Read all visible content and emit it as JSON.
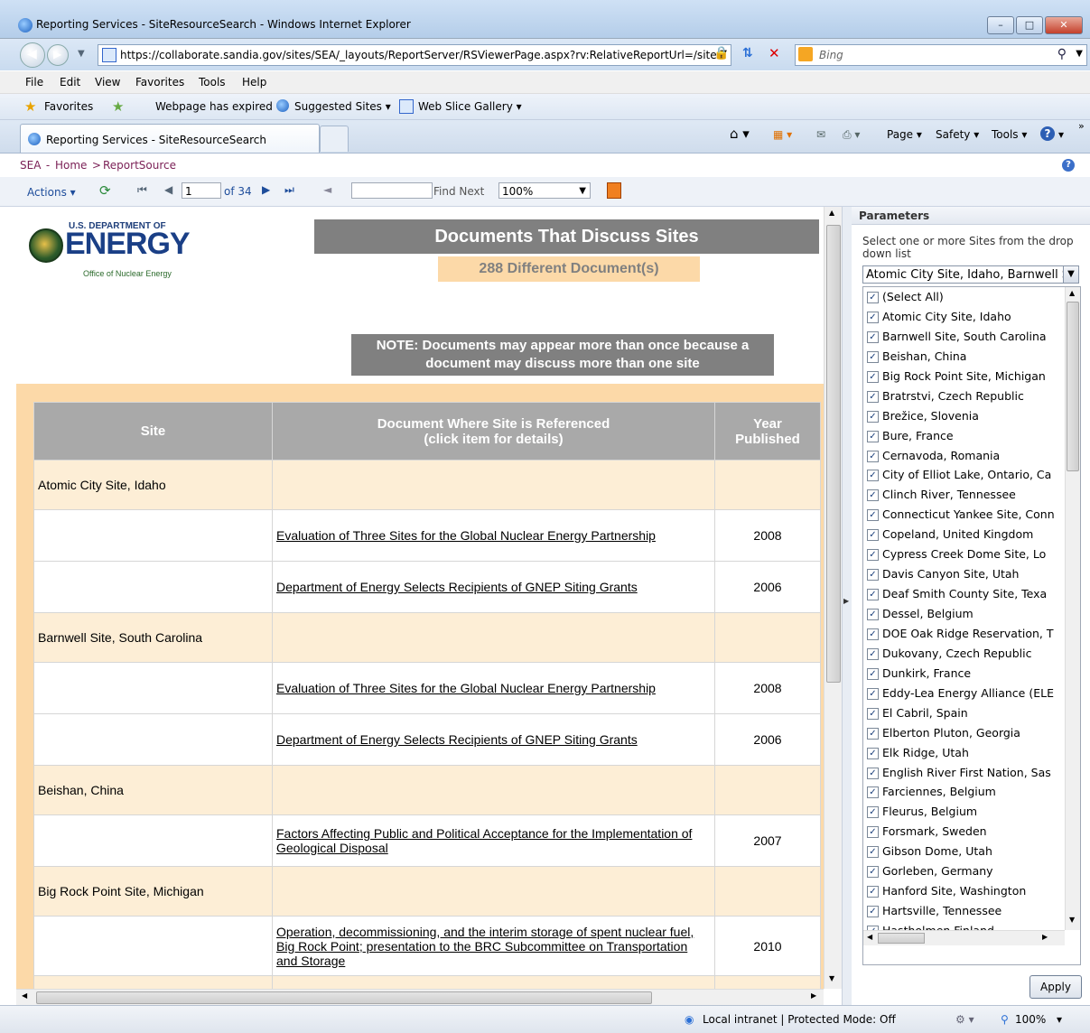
{
  "window": {
    "title": "Reporting Services - SiteResourceSearch - Windows Internet Explorer",
    "address": "https://collaborate.sandia.gov/sites/SEA/_layouts/ReportServer/RSViewerPage.aspx?rv:RelativeReportUrl=/site",
    "search_placeholder": "Bing"
  },
  "menu": [
    "File",
    "Edit",
    "View",
    "Favorites",
    "Tools",
    "Help"
  ],
  "favorites_bar": {
    "favorites": "Favorites",
    "expired": "Webpage has expired",
    "suggested": "Suggested Sites",
    "webslice": "Web Slice Gallery"
  },
  "tab": {
    "label": "Reporting Services - SiteResourceSearch"
  },
  "command_bar": {
    "page": "Page",
    "safety": "Safety",
    "tools": "Tools"
  },
  "breadcrumb": {
    "sea": "SEA",
    "home": "Home",
    "source": "ReportSource",
    "sep1": " - ",
    "sep2": " > "
  },
  "report_toolbar": {
    "actions": "Actions",
    "page_input": "1",
    "page_of": "of 34",
    "find_next": "Find Next",
    "zoom": "100%"
  },
  "report": {
    "logo_line1": "U.S. DEPARTMENT OF",
    "logo_line2": "ENERGY",
    "logo_line3": "Office of Nuclear Energy",
    "title": "Documents That Discuss Sites",
    "count": "288  Different Document(s)",
    "note_line1": "NOTE: Documents may appear more than once because a",
    "note_line2": "document may discuss more than one site",
    "columns": {
      "site": "Site",
      "doc_line1": "Document Where Site is Referenced",
      "doc_line2": "(click item for details)",
      "year_line1": "Year",
      "year_line2": "Published"
    },
    "rows": [
      {
        "type": "site",
        "site": "Atomic City Site, Idaho"
      },
      {
        "type": "doc",
        "doc": "Evaluation of Three Sites for the Global Nuclear Energy Partnership",
        "year": "2008"
      },
      {
        "type": "doc",
        "doc": "Department of Energy Selects Recipients of GNEP Siting Grants",
        "year": "2006"
      },
      {
        "type": "site",
        "site": "Barnwell Site, South Carolina"
      },
      {
        "type": "doc",
        "doc": "Evaluation of Three Sites for the Global Nuclear Energy Partnership",
        "year": "2008"
      },
      {
        "type": "doc",
        "doc": "Department of Energy Selects Recipients of GNEP Siting Grants",
        "year": "2006"
      },
      {
        "type": "site",
        "site": "Beishan, China"
      },
      {
        "type": "doc",
        "doc": "Factors Affecting Public and Political Acceptance for the Implementation of Geological Disposal",
        "year": "2007"
      },
      {
        "type": "site",
        "site": "Big Rock Point Site, Michigan"
      },
      {
        "type": "doc",
        "doc": "Operation, decommissioning, and the interim storage of spent nuclear fuel, Big Rock Point; presentation to the BRC Subcommittee on Transportation and Storage",
        "year": "2010"
      }
    ]
  },
  "parameters": {
    "header": "Parameters",
    "prompt": "Select one or more Sites from the drop down list",
    "selected": "Atomic City Site, Idaho, Barnwell S",
    "items": [
      "(Select All)",
      "Atomic City Site, Idaho",
      "Barnwell Site, South Carolina",
      "Beishan, China",
      "Big Rock Point Site, Michigan",
      "Bratrstvi, Czech Republic",
      "Brežice, Slovenia",
      "Bure, France",
      "Cernavoda, Romania",
      "City of Elliot Lake, Ontario, Ca",
      "Clinch River, Tennessee",
      "Connecticut Yankee Site, Conn",
      "Copeland, United Kingdom",
      "Cypress Creek Dome Site, Lo",
      "Davis Canyon Site, Utah",
      "Deaf Smith County Site, Texa",
      "Dessel, Belgium",
      "DOE Oak Ridge Reservation, T",
      "Dukovany, Czech Republic",
      "Dunkirk, France",
      "Eddy-Lea Energy Alliance (ELE",
      "El Cabril, Spain",
      "Elberton Pluton, Georgia",
      "Elk Ridge, Utah",
      "English River First Nation, Sas",
      "Farciennes, Belgium",
      "Fleurus, Belgium",
      "Forsmark, Sweden",
      "Gibson Dome, Utah",
      "Gorleben, Germany",
      "Hanford Site, Washington",
      "Hartsville, Tennessee",
      "Hastholmen Finland"
    ],
    "apply": "Apply"
  },
  "status": {
    "zone": "Local intranet | Protected Mode: Off",
    "zoom": "100%"
  }
}
